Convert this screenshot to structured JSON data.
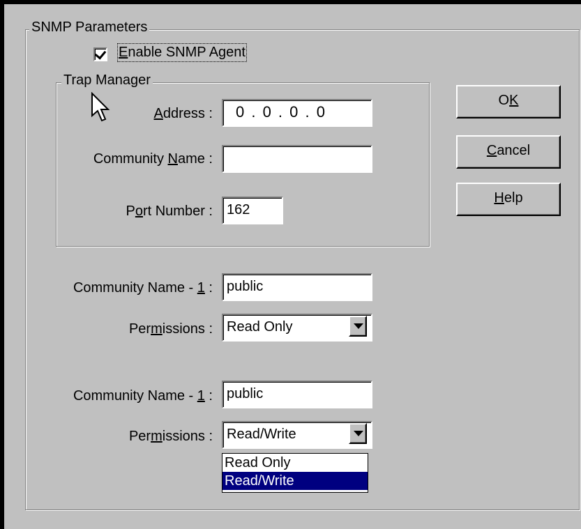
{
  "snmp_group": {
    "title": "SNMP Parameters",
    "enable_agent": {
      "checked": true,
      "label_pre": "",
      "label_mnemonic": "E",
      "label_post": "nable SNMP Agent"
    }
  },
  "trap_manager": {
    "title": "Trap Manager",
    "address": {
      "label_pre": "",
      "label_mnemonic": "A",
      "label_post": "ddress :",
      "value": "0 . 0 . 0 . 0"
    },
    "community": {
      "label_pre": "Community ",
      "label_mnemonic": "N",
      "label_post": "ame :",
      "value": ""
    },
    "port": {
      "label_pre": "P",
      "label_mnemonic": "o",
      "label_post": "rt Number :",
      "value": "162"
    }
  },
  "buttons": {
    "ok": {
      "pre": "O",
      "mnemonic": "K",
      "post": ""
    },
    "cancel": {
      "pre": "",
      "mnemonic": "C",
      "post": "ancel"
    },
    "help": {
      "pre": "",
      "mnemonic": "H",
      "post": "elp"
    }
  },
  "community1": {
    "label_pre": "Community Name - ",
    "label_mnemonic": "1",
    "label_post": " :",
    "value": "public",
    "perm_label_pre": "Per",
    "perm_label_mnemonic": "m",
    "perm_label_post": "issions :",
    "perm_value": "Read Only"
  },
  "community2": {
    "label_pre": "Community Name - ",
    "label_mnemonic": "1",
    "label_post": " :",
    "value": "public",
    "perm_label_pre": "Per",
    "perm_label_mnemonic": "m",
    "perm_label_post": "issions :",
    "perm_value": "Read/Write",
    "options": [
      "Read Only",
      "Read/Write"
    ],
    "selected_option": "Read/Write"
  },
  "icons": {
    "cursor": "arrow-cursor-icon",
    "dropdown": "chevron-down-icon",
    "checkbox": "checkmark-icon"
  },
  "colors": {
    "dialog_bg": "#c0c0c0",
    "selection": "#000080",
    "selection_text": "#ffffff"
  }
}
